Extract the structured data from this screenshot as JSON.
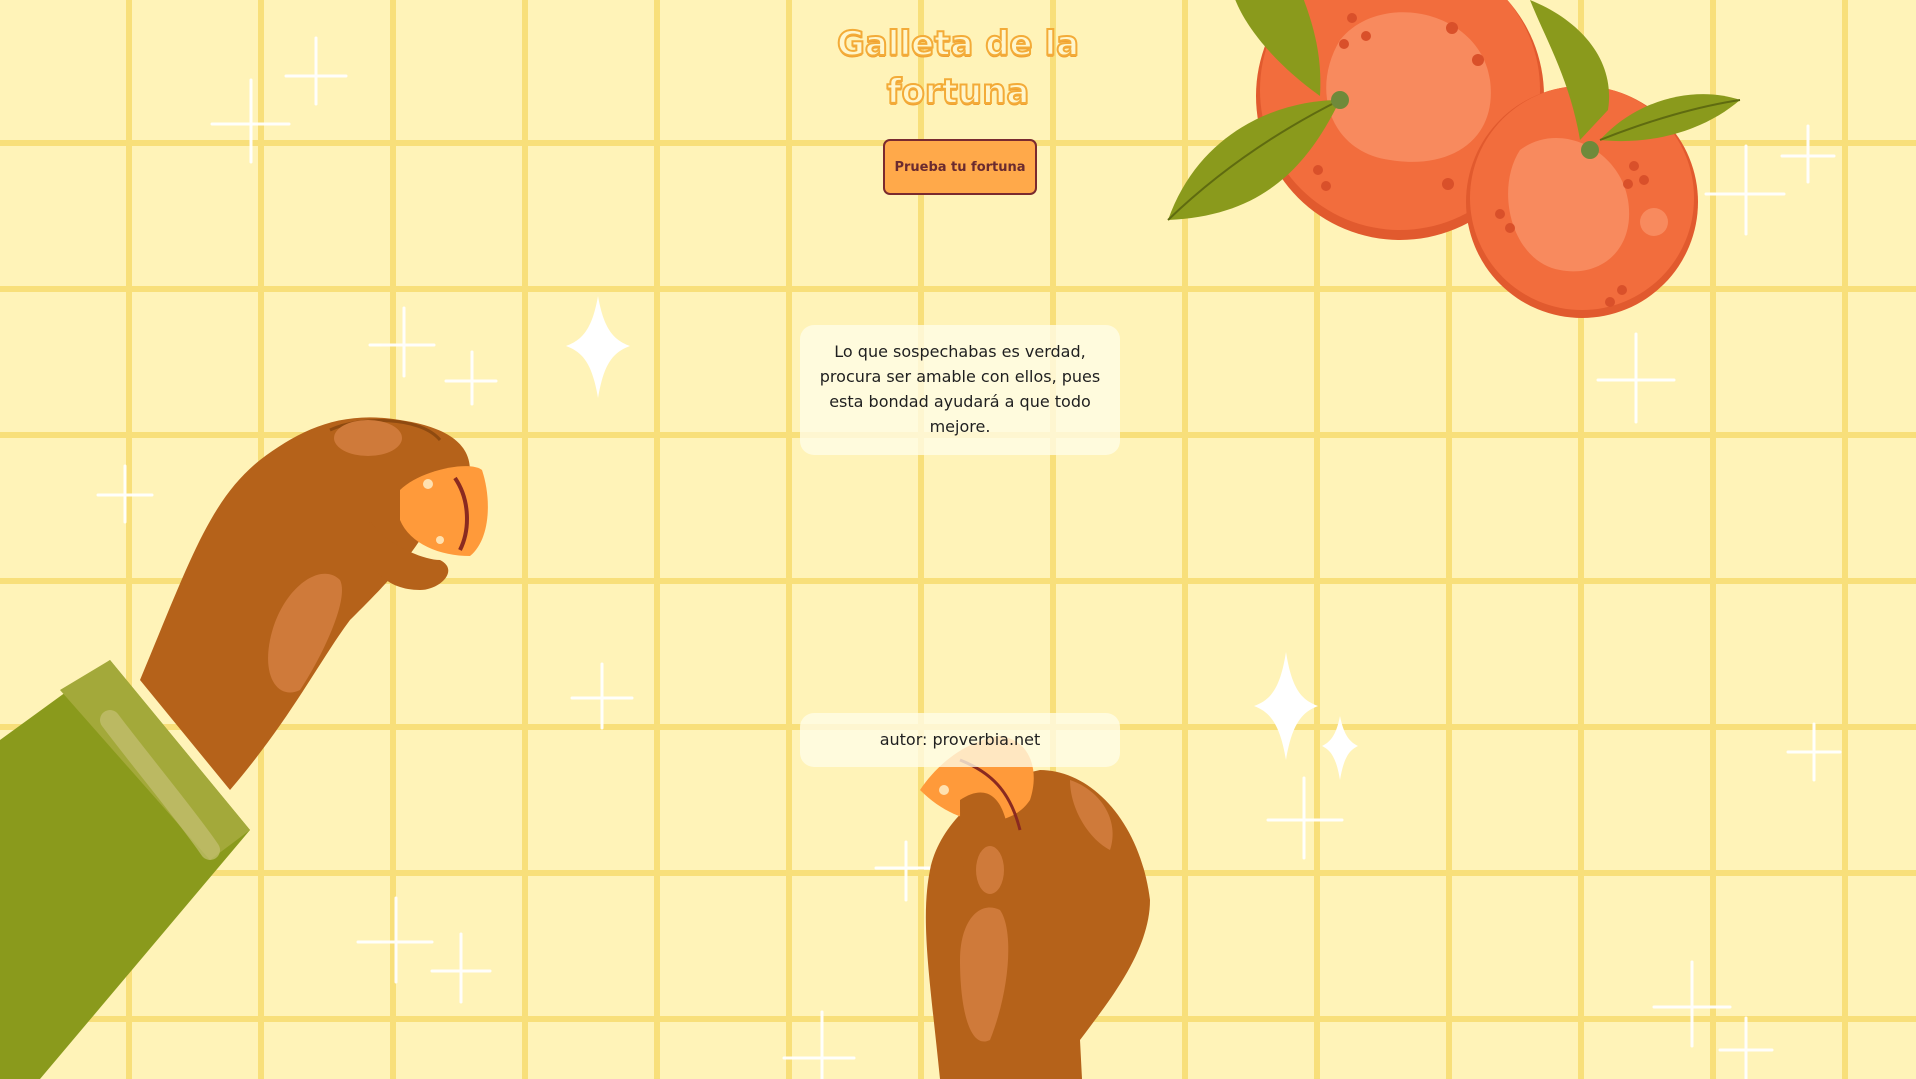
{
  "colors": {
    "background": "#fff3b8",
    "grid": "#f8df7a",
    "button": "#ffa94a",
    "button_border": "#7a2a2f",
    "title_fill": "#fff6cc",
    "title_outline": "#f3ab38",
    "orange": "#f26d3d",
    "leaf": "#8a9a1c",
    "skin": "#b5621a",
    "sleeve": "#8a9a1c"
  },
  "header": {
    "title": "Galleta de la fortuna"
  },
  "actions": {
    "try_label": "Prueba tu fortuna"
  },
  "fortune": {
    "message": "Lo que sospechabas es verdad, procura ser amable con ellos, pues esta bondad ayudará a que todo mejore.",
    "author_prefix": "autor:",
    "author_name": "proverbia.net"
  },
  "illustrations": {
    "oranges": "oranges-with-leaves",
    "left_hand": "hand-holding-cookie-half",
    "bottom_hand": "hand-holding-cookie-half",
    "sparkles": "sparkle-stars"
  }
}
